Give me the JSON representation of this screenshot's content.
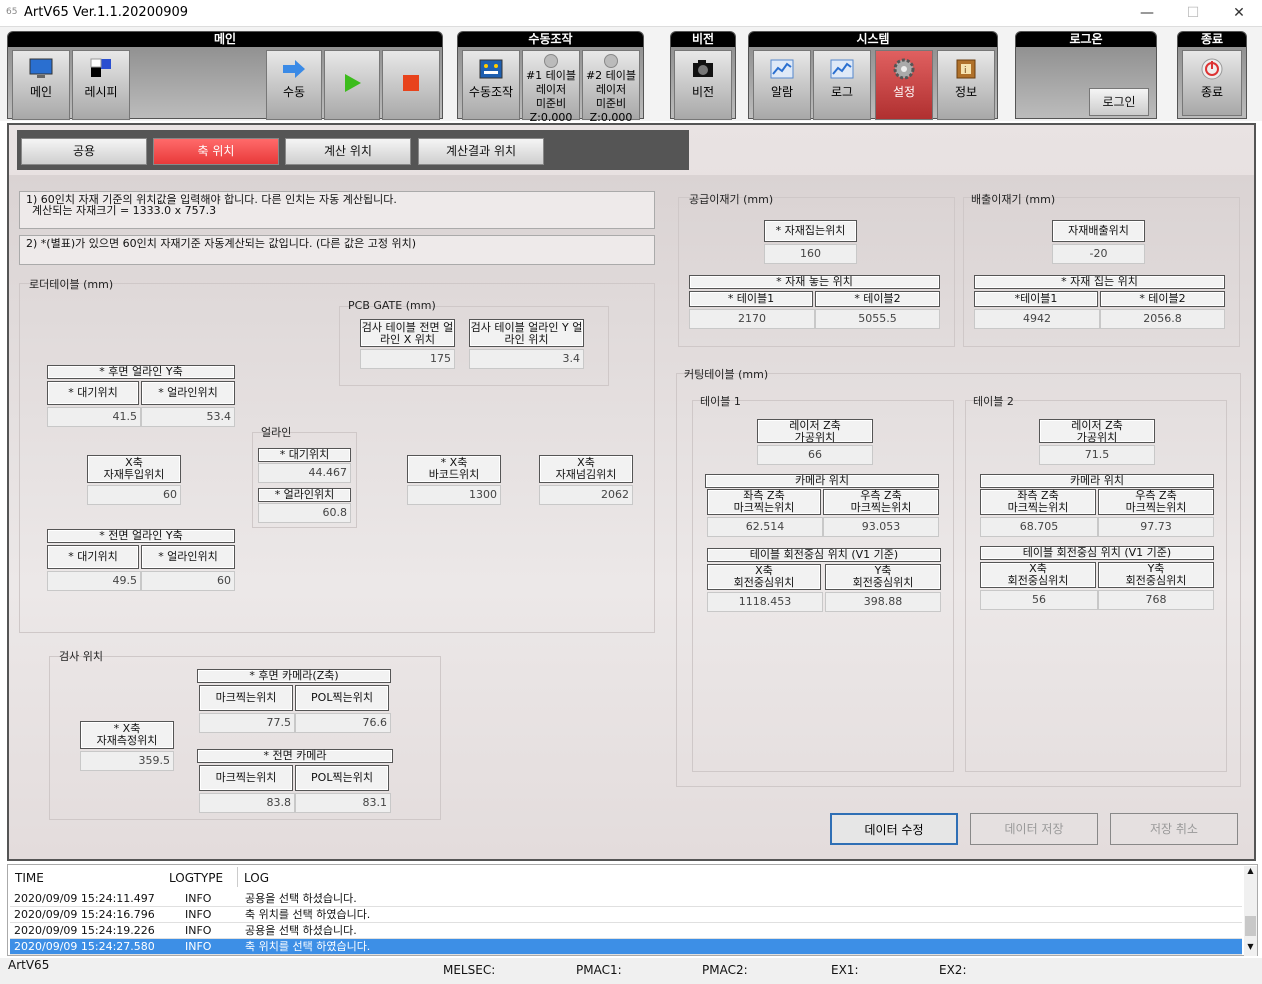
{
  "window": {
    "title": "ArtV65 Ver.1.1.20200909",
    "icon": "65",
    "min": "—",
    "max": "☐",
    "close": "✕"
  },
  "toolbar": {
    "main": {
      "title": "메인",
      "buttons": [
        "메인",
        "레시피",
        "수동"
      ]
    },
    "manual": {
      "title": "수동조작",
      "buttons": [
        "수동조작"
      ],
      "laser1": [
        "#1 테이블",
        "레이저",
        "미준비",
        "Z:0.000"
      ],
      "laser2": [
        "#2 테이블",
        "레이저",
        "미준비",
        "Z:0.000"
      ]
    },
    "vision": {
      "title": "비전",
      "buttons": [
        "비전"
      ]
    },
    "system": {
      "title": "시스템",
      "buttons": [
        "알람",
        "로그",
        "설정",
        "정보"
      ]
    },
    "login": {
      "title": "로그온",
      "button": "로그인"
    },
    "exit": {
      "title": "종료",
      "button": "종료"
    }
  },
  "tabs": [
    "공용",
    "축 위치",
    "계산 위치",
    "계산결과 위치"
  ],
  "notes": {
    "n1a": "1) 60인치 자재 기준의 위치값을 입력해야 합니다. 다른 인치는 자동 계산됩니다.",
    "n1b": "계산되는 자재크기 = 1333.0 x 757.3",
    "n2": "2) *(별표)가 있으면 60인치 자재기준 자동계산되는 값입니다. (다른 값은 고정 위치)"
  },
  "loader": {
    "title": "로더테이블 (mm)",
    "rear_align": {
      "header": "* 후면 얼라인 Y축",
      "wait": "* 대기위치",
      "align": "* 얼라인위치",
      "wait_val": "41.5",
      "align_val": "53.4"
    },
    "pcb_gate": {
      "title": "PCB GATE (mm)",
      "c1": "검사 테이블 전면 얼라인 X 위치",
      "c2": "검사 테이블 얼라인 Y 얼라인 위치",
      "v1": "175",
      "v2": "3.4"
    },
    "align": {
      "title": "얼라인",
      "wait": "* 대기위치",
      "wait_val": "44.467",
      "pos": "* 얼라인위치",
      "pos_val": "60.8"
    },
    "x_input": {
      "l1": "X축",
      "l2": "자재투입위치",
      "val": "60"
    },
    "x_barcode": {
      "l1": "* X축",
      "l2": "바코드위치",
      "val": "1300"
    },
    "x_pass": {
      "l1": "X축",
      "l2": "자재넘김위치",
      "val": "2062"
    },
    "front_align": {
      "header": "* 전면 얼라인 Y축",
      "wait": "* 대기위치",
      "align": "* 얼라인위치",
      "wait_val": "49.5",
      "align_val": "60"
    }
  },
  "inspect": {
    "title": "검사 위치",
    "x": {
      "l1": "* X축",
      "l2": "자재측정위치",
      "val": "359.5"
    },
    "rear": {
      "header": "* 후면 카메라(Z축)",
      "mark": "마크찍는위치",
      "pol": "POL찍는위치",
      "mark_val": "77.5",
      "pol_val": "76.6"
    },
    "front": {
      "header": "* 전면 카메라",
      "mark": "마크찍는위치",
      "pol": "POL찍는위치",
      "mark_val": "83.8",
      "pol_val": "83.1"
    }
  },
  "supply": {
    "title": "공급이재기 (mm)",
    "pick": "* 자재집는위치",
    "pick_val": "160",
    "place": "* 자재 놓는 위치",
    "t1": "* 테이블1",
    "t2": "* 테이블2",
    "t1_val": "2170",
    "t2_val": "5055.5"
  },
  "discharge": {
    "title": "배출이재기 (mm)",
    "out": "자재배출위치",
    "out_val": "-20",
    "pick": "* 자재 집는 위치",
    "t1": "*테이블1",
    "t2": "* 테이블2",
    "t1_val": "4942",
    "t2_val": "2056.8"
  },
  "cutting": {
    "title": "커팅테이블 (mm)",
    "t1": {
      "title": "테이블 1",
      "laser_l1": "레이저 Z축",
      "laser_l2": "가공위치",
      "laser_val": "66",
      "cam": "카메라 위치",
      "left_l1": "좌측 Z축",
      "left_l2": "마크찍는위치",
      "right_l1": "우측 Z축",
      "right_l2": "마크찍는위치",
      "left_val": "62.514",
      "right_val": "93.053",
      "rot": "테이블 회전중심 위치 (V1 기준)",
      "x_l1": "X축",
      "x_l2": "회전중심위치",
      "y_l1": "Y축",
      "y_l2": "회전중심위치",
      "x_val": "1118.453",
      "y_val": "398.88"
    },
    "t2": {
      "title": "테이블 2",
      "laser_l1": "레이저 Z축",
      "laser_l2": "가공위치",
      "laser_val": "71.5",
      "cam": "카메라 위치",
      "left_l1": "좌측 Z축",
      "left_l2": "마크찍는위치",
      "right_l1": "우측 Z축",
      "right_l2": "마크찍는위치",
      "left_val": "68.705",
      "right_val": "97.73",
      "rot": "테이블 회전중심 위치 (V1 기준)",
      "x_l1": "X축",
      "x_l2": "회전중심위치",
      "y_l1": "Y축",
      "y_l2": "회전중심위치",
      "x_val": "56",
      "y_val": "768"
    }
  },
  "actions": {
    "edit": "데이터 수정",
    "save": "데이터 저장",
    "cancel": "저장 취소"
  },
  "log": {
    "h_time": "TIME",
    "h_type": "LOGTYPE",
    "h_log": "LOG",
    "rows": [
      {
        "time": "2020/09/09 15:24:11.497",
        "type": "INFO",
        "msg": "공용을 선택 하셨습니다."
      },
      {
        "time": "2020/09/09 15:24:16.796",
        "type": "INFO",
        "msg": "축 위치를 선택 하였습니다."
      },
      {
        "time": "2020/09/09 15:24:19.226",
        "type": "INFO",
        "msg": "공용을 선택 하셨습니다."
      },
      {
        "time": "2020/09/09 15:24:27.580",
        "type": "INFO",
        "msg": "축 위치를 선택 하였습니다."
      }
    ]
  },
  "status": {
    "app": "ArtV65",
    "melsec": "MELSEC:",
    "pmac1": "PMAC1:",
    "pmac2": "PMAC2:",
    "ex1": "EX1:",
    "ex2": "EX2:"
  }
}
